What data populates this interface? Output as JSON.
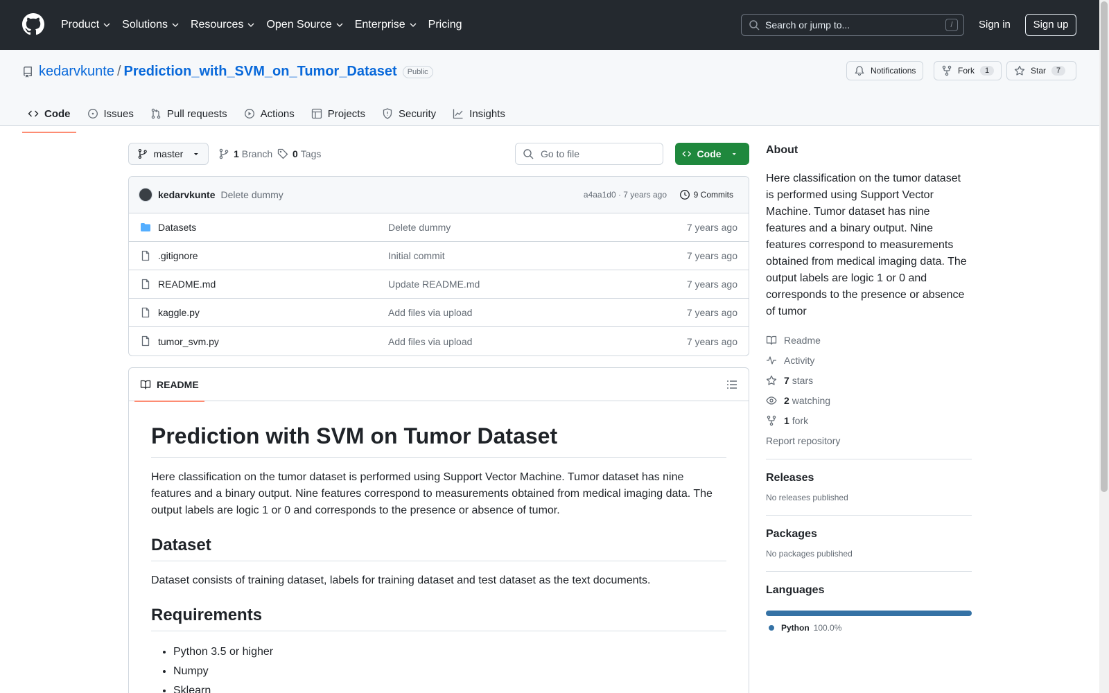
{
  "header": {
    "nav": [
      "Product",
      "Solutions",
      "Resources",
      "Open Source",
      "Enterprise",
      "Pricing"
    ],
    "search_placeholder": "Search or jump to...",
    "search_shortcut": "/",
    "signin": "Sign in",
    "signup": "Sign up"
  },
  "repo": {
    "owner": "kedarvkunte",
    "separator": "/",
    "name": "Prediction_with_SVM_on_Tumor_Dataset",
    "visibility": "Public",
    "notifications": "Notifications",
    "fork_label": "Fork",
    "fork_count": "1",
    "star_label": "Star",
    "star_count": "7",
    "tabs": [
      "Code",
      "Issues",
      "Pull requests",
      "Actions",
      "Projects",
      "Security",
      "Insights"
    ]
  },
  "toolbar": {
    "branch": "master",
    "branch_count": "1",
    "branch_label": "Branch",
    "tag_count": "0",
    "tag_label": "Tags",
    "goto_placeholder": "Go to file",
    "code_button": "Code"
  },
  "commit": {
    "author": "kedarvkunte",
    "message": "Delete dummy",
    "sha_time": "a4aa1d0 · 7 years ago",
    "commits": "9 Commits"
  },
  "files": [
    {
      "name": "Datasets",
      "type": "folder",
      "message": "Delete dummy",
      "date": "7 years ago"
    },
    {
      "name": ".gitignore",
      "type": "file",
      "message": "Initial commit",
      "date": "7 years ago"
    },
    {
      "name": "README.md",
      "type": "file",
      "message": "Update README.md",
      "date": "7 years ago"
    },
    {
      "name": "kaggle.py",
      "type": "file",
      "message": "Add files via upload",
      "date": "7 years ago"
    },
    {
      "name": "tumor_svm.py",
      "type": "file",
      "message": "Add files via upload",
      "date": "7 years ago"
    }
  ],
  "readme": {
    "tab_label": "README",
    "h1": "Prediction with SVM on Tumor Dataset",
    "intro": "Here classification on the tumor dataset is performed using Support Vector Machine. Tumor dataset has nine features and a binary output. Nine features correspond to measurements obtained from medical imaging data. The output labels are logic 1 or 0 and corresponds to the presence or absence of tumor.",
    "h2_dataset": "Dataset",
    "dataset_text": "Dataset consists of training dataset, labels for training dataset and test dataset as the text documents.",
    "h2_requirements": "Requirements",
    "requirements": [
      "Python 3.5 or higher",
      "Numpy",
      "Sklearn"
    ]
  },
  "sidebar": {
    "about_title": "About",
    "about_text": "Here classification on the tumor dataset is performed using Support Vector Machine. Tumor dataset has nine features and a binary output. Nine features correspond to measurements obtained from medical imaging data. The output labels are logic 1 or 0 and corresponds to the presence or absence of tumor",
    "readme": "Readme",
    "activity": "Activity",
    "stars_count": "7",
    "stars_label": "stars",
    "watching_count": "2",
    "watching_label": "watching",
    "fork_count": "1",
    "fork_label": "fork",
    "report": "Report repository",
    "releases_title": "Releases",
    "releases_text": "No releases published",
    "packages_title": "Packages",
    "packages_text": "No packages published",
    "languages_title": "Languages",
    "language_name": "Python",
    "language_pct": "100.0%",
    "language_color": "#3572a5"
  }
}
